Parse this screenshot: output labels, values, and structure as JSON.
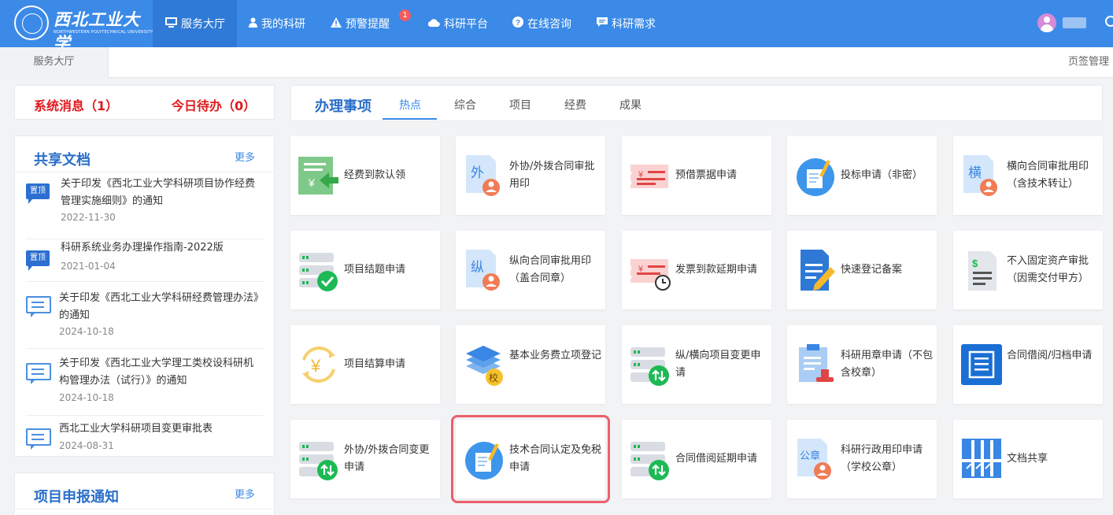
{
  "header": {
    "university_name": "西北工业大学",
    "university_name_en": "NORTHWESTERN POLYTECHNICAL UNIVERSITY",
    "nav": [
      {
        "label": "服务大厅",
        "icon": "monitor-icon",
        "active": true
      },
      {
        "label": "我的科研",
        "icon": "user-icon"
      },
      {
        "label": "预警提醒",
        "icon": "warning-icon",
        "badge": "1"
      },
      {
        "label": "科研平台",
        "icon": "cloud-icon"
      },
      {
        "label": "在线咨询",
        "icon": "question-icon"
      },
      {
        "label": "科研需求",
        "icon": "message-icon"
      }
    ]
  },
  "tabbar": {
    "current_tab": "服务大厅",
    "manage_label": "页签管理"
  },
  "messages": {
    "system": "系统消息（1）",
    "todo": "今日待办（0）"
  },
  "shared_docs": {
    "title": "共享文档",
    "more": "更多",
    "pin_label": "置顶",
    "items": [
      {
        "title": "关于印发《西北工业大学科研项目协作经费管理实施细则》的通知",
        "date": "2022-11-30",
        "icon": "pin-badge-icon"
      },
      {
        "title": "科研系统业务办理操作指南-2022版",
        "date": "2021-01-04",
        "icon": "pin-badge-icon"
      },
      {
        "title": "关于印发《西北工业大学科研经费管理办法》的通知",
        "date": "2024-10-18",
        "icon": "document-chat-icon"
      },
      {
        "title": "关于印发《西北工业大学理工类校设科研机构管理办法（试行）》的通知",
        "date": "2024-10-18",
        "icon": "document-chat-icon"
      },
      {
        "title": "西北工业大学科研项目变更审批表",
        "date": "2024-08-31",
        "icon": "document-chat-icon"
      }
    ]
  },
  "project_notice": {
    "title": "项目申报通知",
    "more": "更多"
  },
  "affairs": {
    "title": "办理事项",
    "tabs": [
      "热点",
      "综合",
      "项目",
      "经费",
      "成果"
    ],
    "selected_tab": "热点",
    "tiles": [
      {
        "label": "经费到款认领",
        "icon": "fund-claim-icon"
      },
      {
        "label": "外协/外拨合同审批用印",
        "icon": "external-contract-icon"
      },
      {
        "label": "预借票据申请",
        "icon": "invoice-advance-icon"
      },
      {
        "label": "投标申请（非密）",
        "icon": "bid-application-icon"
      },
      {
        "label": "横向合同审批用印（含技术转让）",
        "icon": "horizontal-contract-icon"
      },
      {
        "label": "项目结题申请",
        "icon": "project-closure-icon"
      },
      {
        "label": "纵向合同审批用印（盖合同章）",
        "icon": "vertical-contract-icon"
      },
      {
        "label": "发票到款延期申请",
        "icon": "invoice-delay-icon"
      },
      {
        "label": "快速登记备案",
        "icon": "quick-register-icon"
      },
      {
        "label": "不入固定资产审批（因需交付甲方）",
        "icon": "non-fixed-asset-icon"
      },
      {
        "label": "项目结算申请",
        "icon": "project-settlement-icon"
      },
      {
        "label": "基本业务费立项登记",
        "icon": "basic-fund-icon"
      },
      {
        "label": "纵/横向项目变更申请",
        "icon": "project-change-icon"
      },
      {
        "label": "科研用章申请（不包含校章）",
        "icon": "seal-application-icon"
      },
      {
        "label": "合同借阅/归档申请",
        "icon": "contract-archive-icon"
      },
      {
        "label": "外协/外拨合同变更申请",
        "icon": "external-change-icon"
      },
      {
        "label": "技术合同认定及免税申请",
        "icon": "tech-contract-icon",
        "highlighted": true
      },
      {
        "label": "合同借阅延期申请",
        "icon": "borrow-delay-icon"
      },
      {
        "label": "科研行政用印申请（学校公章）",
        "icon": "admin-seal-icon"
      },
      {
        "label": "文档共享",
        "icon": "document-share-icon"
      }
    ],
    "icon_glyphs": {
      "external": "外",
      "horizontal": "横",
      "vertical": "纵",
      "school": "校",
      "seal": "公章",
      "yen": "¥",
      "dollar": "$"
    }
  },
  "colors": {
    "brand": "#3b8ae8",
    "alert_red": "#e0191e",
    "title_blue": "#2a6fc9",
    "highlight": "#ec5f6c",
    "green": "#1db954"
  }
}
